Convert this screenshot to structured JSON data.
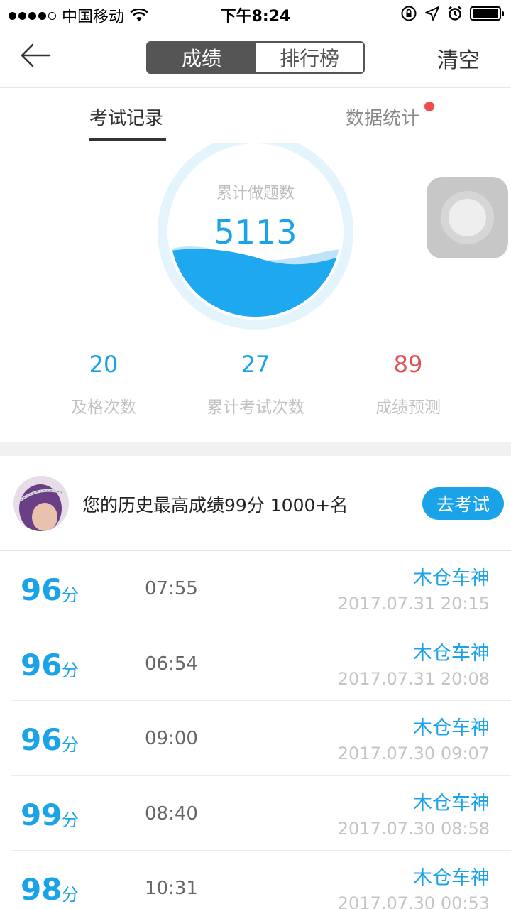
{
  "status_bar": {
    "carrier": "中国移动",
    "time": "下午8:24"
  },
  "nav": {
    "segments": [
      "成绩",
      "排行榜"
    ],
    "active_segment": "成绩",
    "clear_label": "清空"
  },
  "sub_tabs": {
    "items": [
      "考试记录",
      "数据统计"
    ],
    "active": "考试记录"
  },
  "stats": {
    "total_label": "累计做题数",
    "total_value": "5113",
    "metrics": [
      {
        "value": "20",
        "label": "及格次数"
      },
      {
        "value": "27",
        "label": "累计考试次数"
      },
      {
        "value": "89",
        "label": "成绩预测"
      }
    ]
  },
  "best": {
    "text": "您的历史最高成绩99分 1000+名",
    "button_label": "去考试"
  },
  "records": [
    {
      "score": "96",
      "unit": "分",
      "duration": "07:55",
      "user": "木仓车神",
      "date": "2017.07.31 20:15"
    },
    {
      "score": "96",
      "unit": "分",
      "duration": "06:54",
      "user": "木仓车神",
      "date": "2017.07.31 20:08"
    },
    {
      "score": "96",
      "unit": "分",
      "duration": "09:00",
      "user": "木仓车神",
      "date": "2017.07.30 09:07"
    },
    {
      "score": "99",
      "unit": "分",
      "duration": "08:40",
      "user": "木仓车神",
      "date": "2017.07.30 08:58"
    },
    {
      "score": "98",
      "unit": "分",
      "duration": "10:31",
      "user": "木仓车神",
      "date": "2017.07.30 00:53"
    }
  ],
  "colors": {
    "accent": "#1aa3e8",
    "prediction": "#e35050",
    "segment_active": "#555555",
    "badge_dot": "#f24b4b"
  },
  "icons": {
    "back": "arrow-left-icon",
    "wifi": "wifi-icon",
    "rotation_lock": "rotation-lock-icon",
    "location": "location-arrow-icon",
    "alarm": "alarm-clock-icon",
    "battery": "battery-icon",
    "assistive_touch": "assistive-touch-icon"
  }
}
